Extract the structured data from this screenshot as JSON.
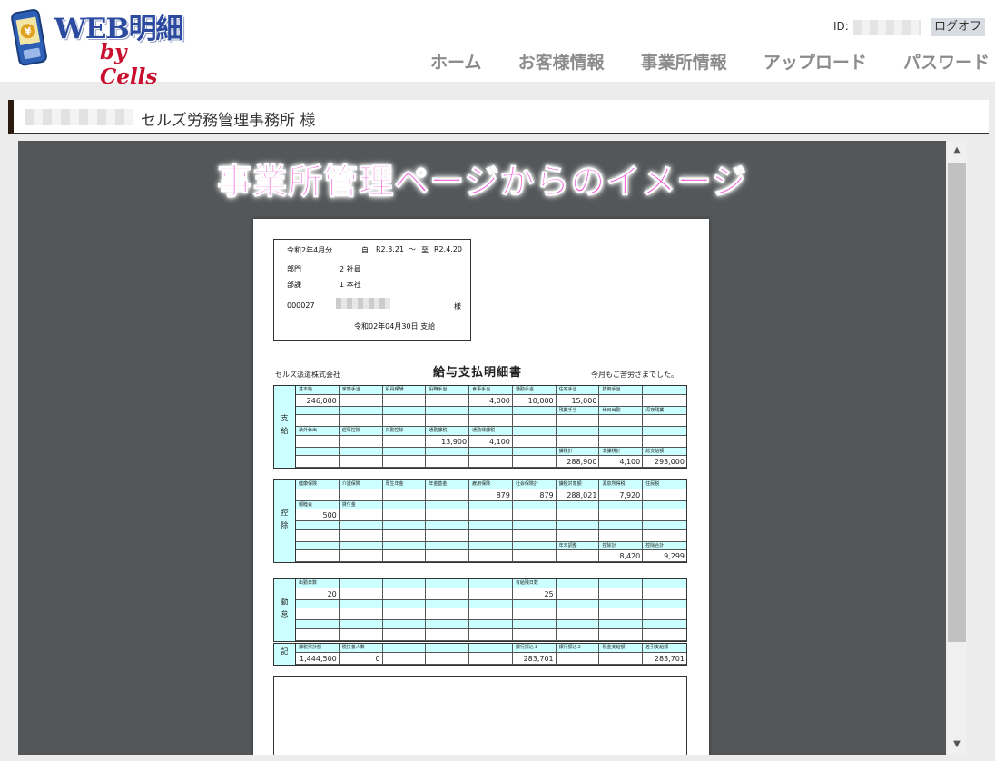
{
  "header": {
    "logo": {
      "title": "WEB明細",
      "subtitle": "by Cells"
    },
    "id_label": "ID:",
    "logout_label": "ログオフ",
    "nav": [
      "ホーム",
      "お客様情報",
      "事業所情報",
      "アップロード",
      "パスワード"
    ]
  },
  "customer": {
    "name": "セルズ労務管理事務所 様"
  },
  "viewer": {
    "caption": "事業所管理ページからのイメージ",
    "document": {
      "period": "令和2年4月分",
      "from_label": "自",
      "from_date": "R2.3.21",
      "tilde": "～",
      "to_label": "至",
      "to_date": "R2.4.20",
      "dept_label": "部門",
      "dept_value": "2 社員",
      "section_label": "部課",
      "section_value": "1 本社",
      "employee_no": "000027",
      "honorific": "様",
      "pay_date": "令和02年04月30日 支給",
      "company": "セルズ派遣株式会社",
      "title": "給与支払明細書",
      "greeting": "今月もご苦労さまでした。",
      "sections": [
        {
          "label": "支給",
          "rows": [
            {
              "type": "h",
              "cells": [
                "基本給",
                "家族手当",
                "役員報酬",
                "役職手当",
                "食事手当",
                "通勤手当",
                "住宅手当",
                "技術手当",
                ""
              ]
            },
            {
              "type": "v",
              "cells": [
                "246,000",
                "",
                "",
                "",
                "4,000",
                "10,000",
                "15,000",
                "",
                ""
              ]
            },
            {
              "type": "h",
              "cells": [
                "",
                "",
                "",
                "",
                "",
                "",
                "残業手当",
                "休日出勤",
                "深夜残業"
              ]
            },
            {
              "type": "v",
              "cells": [
                "",
                "",
                "",
                "",
                "",
                "",
                "",
                "",
                ""
              ]
            },
            {
              "type": "h",
              "cells": [
                "法外休出",
                "遅早控除",
                "欠勤控除",
                "通勤課税",
                "通勤非課税",
                "",
                "",
                "",
                ""
              ]
            },
            {
              "type": "v",
              "cells": [
                "",
                "",
                "",
                "13,900",
                "4,100",
                "",
                "",
                "",
                ""
              ]
            },
            {
              "type": "h",
              "cells": [
                "",
                "",
                "",
                "",
                "",
                "",
                "課税計",
                "非課税計",
                "総支給額"
              ]
            },
            {
              "type": "v",
              "cells": [
                "",
                "",
                "",
                "",
                "",
                "",
                "288,900",
                "4,100",
                "293,000"
              ]
            }
          ]
        },
        {
          "label": "控除",
          "rows": [
            {
              "type": "h",
              "cells": [
                "健康保険",
                "介護保険",
                "厚生年金",
                "年金基金",
                "雇用保険",
                "社会保険計",
                "課税対象額",
                "源泉所得税",
                "住民税"
              ]
            },
            {
              "type": "v",
              "cells": [
                "",
                "",
                "",
                "",
                "879",
                "879",
                "288,021",
                "7,920",
                ""
              ]
            },
            {
              "type": "h",
              "cells": [
                "親睦会",
                "貸付金",
                "",
                "",
                "",
                "",
                "",
                "",
                ""
              ]
            },
            {
              "type": "v",
              "cells": [
                "500",
                "",
                "",
                "",
                "",
                "",
                "",
                "",
                ""
              ]
            },
            {
              "type": "h",
              "cells": [
                "",
                "",
                "",
                "",
                "",
                "",
                "",
                "",
                ""
              ]
            },
            {
              "type": "v",
              "cells": [
                "",
                "",
                "",
                "",
                "",
                "",
                "",
                "",
                ""
              ]
            },
            {
              "type": "h",
              "cells": [
                "",
                "",
                "",
                "",
                "",
                "",
                "年末調整",
                "控除計",
                "控除合計"
              ]
            },
            {
              "type": "v",
              "cells": [
                "",
                "",
                "",
                "",
                "",
                "",
                "",
                "8,420",
                "9,299"
              ]
            }
          ]
        },
        {
          "label": "勤怠",
          "rows": [
            {
              "type": "h",
              "cells": [
                "出勤日数",
                "",
                "",
                "",
                "",
                "有給残日数",
                "",
                "",
                ""
              ]
            },
            {
              "type": "v",
              "cells": [
                "20",
                "",
                "",
                "",
                "",
                "25",
                "",
                "",
                ""
              ]
            },
            {
              "type": "h",
              "cells": [
                "",
                "",
                "",
                "",
                "",
                "",
                "",
                "",
                ""
              ]
            },
            {
              "type": "v",
              "cells": [
                "",
                "",
                "",
                "",
                "",
                "",
                "",
                "",
                ""
              ]
            },
            {
              "type": "h",
              "cells": [
                "",
                "",
                "",
                "",
                "",
                "",
                "",
                "",
                ""
              ]
            },
            {
              "type": "v",
              "cells": [
                "",
                "",
                "",
                "",
                "",
                "",
                "",
                "",
                ""
              ]
            }
          ]
        },
        {
          "label": "記",
          "rows": [
            {
              "type": "h",
              "cells": [
                "課税累計額",
                "税扶養人数",
                "",
                "",
                "",
                "銀行振込１",
                "銀行振込２",
                "現金支給額",
                "差引支給額"
              ]
            },
            {
              "type": "v",
              "cells": [
                "1,444,500",
                "0",
                "",
                "",
                "",
                "283,701",
                "",
                "",
                "283,701"
              ]
            }
          ]
        }
      ]
    }
  }
}
